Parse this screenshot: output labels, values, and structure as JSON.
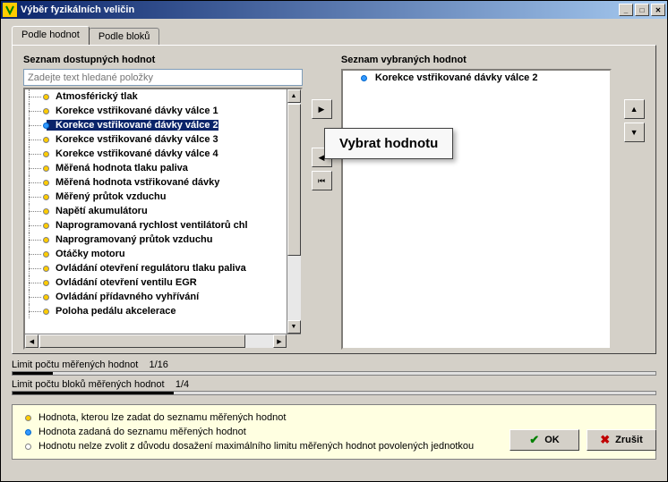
{
  "window": {
    "title": "Výběr fyzikálních veličin"
  },
  "tabs": {
    "active": "Podle hodnot",
    "items": [
      "Podle hodnot",
      "Podle bloků"
    ]
  },
  "left": {
    "title": "Seznam dostupných hodnot",
    "search_placeholder": "Zadejte text hledané položky",
    "items": [
      {
        "label": "Atmosférický tlak",
        "bullet": "yellow"
      },
      {
        "label": "Korekce vstřikované dávky válce 1",
        "bullet": "yellow"
      },
      {
        "label": "Korekce vstřikované dávky válce 2",
        "bullet": "blue",
        "selected": true
      },
      {
        "label": "Korekce vstřikované dávky válce 3",
        "bullet": "yellow"
      },
      {
        "label": "Korekce vstřikované dávky válce 4",
        "bullet": "yellow"
      },
      {
        "label": "Měřená hodnota tlaku paliva",
        "bullet": "yellow"
      },
      {
        "label": "Měřená hodnota vstřikované dávky",
        "bullet": "yellow"
      },
      {
        "label": "Měřený průtok vzduchu",
        "bullet": "yellow"
      },
      {
        "label": "Napětí akumulátoru",
        "bullet": "yellow"
      },
      {
        "label": "Naprogramovaná rychlost ventilátorů chl",
        "bullet": "yellow"
      },
      {
        "label": "Naprogramovaný průtok vzduchu",
        "bullet": "yellow"
      },
      {
        "label": "Otáčky motoru",
        "bullet": "yellow"
      },
      {
        "label": "Ovládání otevření regulátoru tlaku paliva",
        "bullet": "yellow"
      },
      {
        "label": "Ovládání otevření ventilu EGR",
        "bullet": "yellow"
      },
      {
        "label": "Ovládání přídavného vyhřívání",
        "bullet": "yellow"
      },
      {
        "label": "Poloha pedálu akcelerace",
        "bullet": "yellow"
      }
    ]
  },
  "right": {
    "title": "Seznam vybraných hodnot",
    "items": [
      {
        "label": "Korekce vstřikované dávky válce 2",
        "bullet": "blue"
      }
    ]
  },
  "tooltip": "Vybrat hodnotu",
  "limits": {
    "row1": {
      "label": "Limit počtu měřených hodnot",
      "value": "1/16",
      "fill_pct": 6.25
    },
    "row2": {
      "label": "Limit počtu bloků měřených hodnot",
      "value": "1/4",
      "fill_pct": 25
    }
  },
  "legend": {
    "row1": "Hodnota, kterou lze zadat do seznamu měřených hodnot",
    "row2": "Hodnota zadaná do seznamu měřených hodnot",
    "row3": "Hodnotu nelze zvolit z  důvodu dosažení maximálního limitu měřených hodnot povolených jednotkou"
  },
  "buttons": {
    "ok": "OK",
    "cancel": "Zrušit"
  }
}
